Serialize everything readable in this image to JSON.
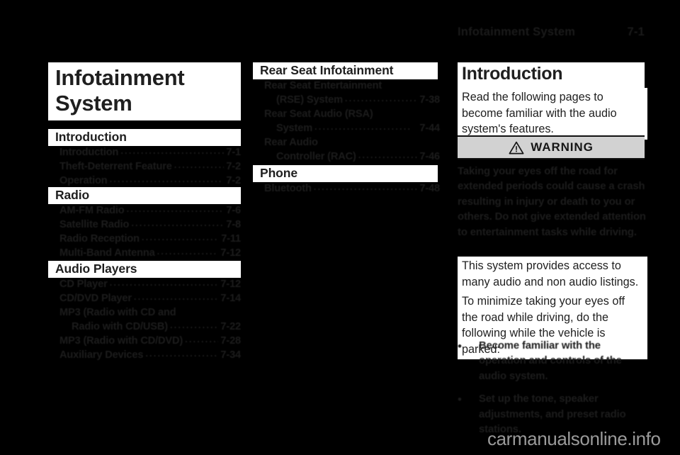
{
  "header": {
    "title": "Infotainment System",
    "page_number": "7-1"
  },
  "chapter_title": {
    "line1": "Infotainment",
    "line2": "System"
  },
  "toc": {
    "column1": [
      {
        "heading": "Introduction",
        "entries": [
          {
            "label": "Introduction",
            "page": "7-1"
          },
          {
            "label": "Theft-Deterrent Feature",
            "page": "7-2"
          },
          {
            "label": "Operation",
            "page": "7-2"
          }
        ]
      },
      {
        "heading": "Radio",
        "entries": [
          {
            "label": "AM-FM Radio",
            "page": "7-6"
          },
          {
            "label": "Satellite Radio",
            "page": "7-8"
          },
          {
            "label": "Radio Reception",
            "page": "7-11"
          },
          {
            "label": "Multi-Band Antenna",
            "page": "7-12"
          }
        ]
      },
      {
        "heading": "Audio Players",
        "entries": [
          {
            "label": "CD Player",
            "page": "7-12"
          },
          {
            "label": "CD/DVD Player",
            "page": "7-14"
          },
          {
            "label": "MP3 (Radio with CD and",
            "page": "",
            "wrap": true
          },
          {
            "label": "Radio with CD/USB)",
            "page": "7-22",
            "continued": true
          },
          {
            "label": "MP3 (Radio with CD/DVD)",
            "page": "7-28"
          },
          {
            "label": "Auxiliary Devices",
            "page": "7-34"
          }
        ]
      }
    ],
    "column2": [
      {
        "heading": "Rear Seat Infotainment",
        "entries": [
          {
            "label": "Rear Seat Entertainment",
            "page": "",
            "wrap": true
          },
          {
            "label": "(RSE) System",
            "page": "7-38",
            "continued": true
          },
          {
            "label": "Rear Seat Audio (RSA)",
            "page": "",
            "wrap": true
          },
          {
            "label": "System",
            "page": "7-44",
            "continued": true
          },
          {
            "label": "Rear Audio",
            "page": "",
            "wrap": true
          },
          {
            "label": "Controller (RAC)",
            "page": "7-46",
            "continued": true
          }
        ]
      },
      {
        "heading": "Phone",
        "entries": [
          {
            "label": "Bluetooth",
            "page": "7-48"
          }
        ]
      }
    ]
  },
  "introduction": {
    "heading": "Introduction",
    "intro_paragraph": "Read the following pages to become familiar with the audio system's features.",
    "warning": {
      "icon": "warning-triangle-icon",
      "label": "WARNING",
      "text": "Taking your eyes off the road for extended periods could cause a crash resulting in injury or death to you or others. Do not give extended attention to entertainment tasks while driving."
    },
    "paragraph2": "This system provides access to many audio and non audio listings.",
    "paragraph3": "To minimize taking your eyes off the road while driving, do the following while the vehicle is parked:",
    "bullets": [
      "Become familiar with the operation and controls of the audio system.",
      "Set up the tone, speaker adjustments, and preset radio stations."
    ],
    "bullet_glyph": "•"
  },
  "watermark": "carmanualsonline.info",
  "colors": {
    "page_background": "#000000",
    "box_background": "#ffffff",
    "text": "#1f1f1f",
    "warning_bar": "#d2d2d2",
    "watermark": "#9a9a9a"
  }
}
